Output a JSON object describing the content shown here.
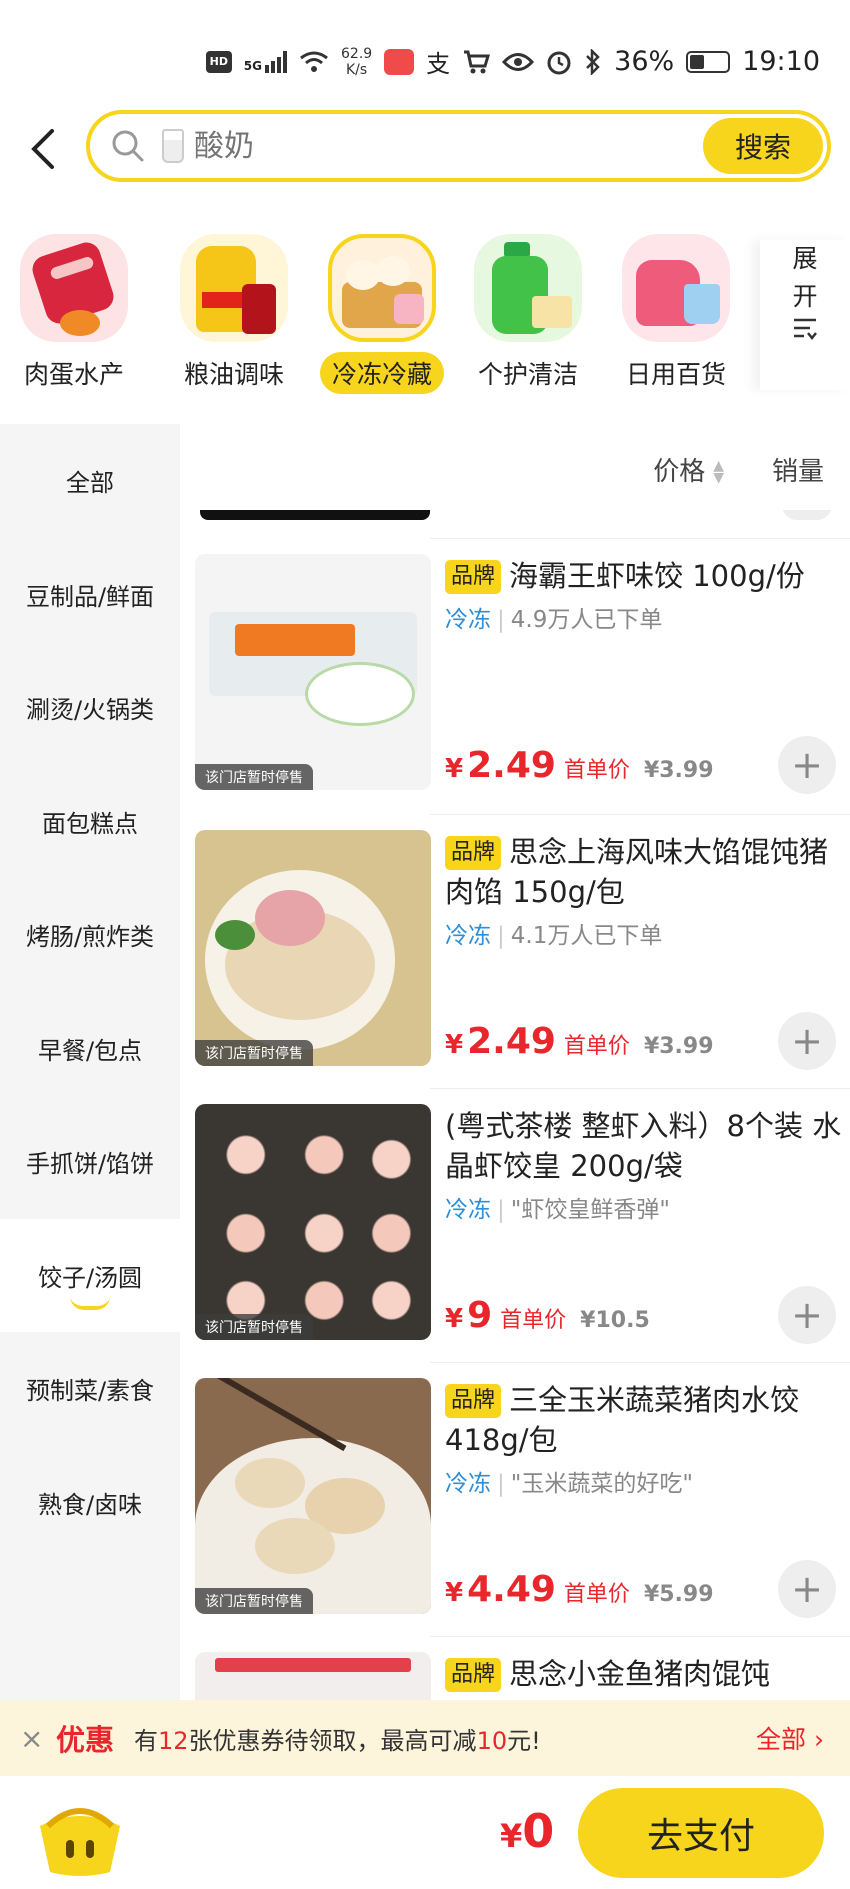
{
  "status_bar": {
    "hd": "HD",
    "net_type": "5G",
    "speed_value": "62.9",
    "speed_unit": "K/s",
    "battery": "36%",
    "time": "19:10"
  },
  "search": {
    "placeholder": "酸奶",
    "button": "搜索"
  },
  "categories": [
    {
      "label": "肉蛋水产",
      "active": false
    },
    {
      "label": "粮油调味",
      "active": false
    },
    {
      "label": "冷冻冷藏",
      "active": true
    },
    {
      "label": "个护清洁",
      "active": false
    },
    {
      "label": "日用百货",
      "active": false
    }
  ],
  "expand": {
    "line1": "展",
    "line2": "开"
  },
  "sidebar": {
    "items": [
      {
        "label": "全部"
      },
      {
        "label": "豆制品/鲜面"
      },
      {
        "label": "涮烫/火锅类"
      },
      {
        "label": "面包糕点"
      },
      {
        "label": "烤肠/煎炸类"
      },
      {
        "label": "早餐/包点"
      },
      {
        "label": "手抓饼/馅饼"
      },
      {
        "label": "饺子/汤圆"
      },
      {
        "label": "预制菜/素食"
      },
      {
        "label": "熟食/卤味"
      }
    ]
  },
  "sort": {
    "price": "价格",
    "sales": "销量"
  },
  "products": [
    {
      "brand": "品牌",
      "title": "海霸王虾味饺 100g/份",
      "frozen": "冷冻",
      "tag": "4.9万人已下单",
      "yen": "¥",
      "price": "2.49",
      "first": "首单价",
      "orig": "¥3.99",
      "paused": "该门店暂时停售"
    },
    {
      "brand": "品牌",
      "title": "思念上海风味大馅馄饨猪肉馅 150g/包",
      "frozen": "冷冻",
      "tag": "4.1万人已下单",
      "yen": "¥",
      "price": "2.49",
      "first": "首单价",
      "orig": "¥3.99",
      "paused": "该门店暂时停售"
    },
    {
      "brand": "",
      "title": "(粤式茶楼 整虾入料）8个装 水晶虾饺皇 200g/袋",
      "frozen": "冷冻",
      "tag": "\"虾饺皇鲜香弹\"",
      "yen": "¥",
      "price": "9",
      "first": "首单价",
      "orig": "¥10.5",
      "paused": "该门店暂时停售"
    },
    {
      "brand": "品牌",
      "title": "三全玉米蔬菜猪肉水饺 418g/包",
      "frozen": "冷冻",
      "tag": "\"玉米蔬菜的好吃\"",
      "yen": "¥",
      "price": "4.49",
      "first": "首单价",
      "orig": "¥5.99",
      "paused": "该门店暂时停售"
    },
    {
      "brand": "品牌",
      "title": "思念小金鱼猪肉馄饨",
      "frozen": "",
      "tag": "",
      "yen": "",
      "price": "",
      "first": "",
      "orig": "",
      "paused": ""
    }
  ],
  "coupon": {
    "close": "×",
    "title": "优惠",
    "text_a": "有",
    "count": "12",
    "text_b": "张优惠券待领取，最高可减",
    "amount": "10",
    "text_c": "元!",
    "all": "全部 ›"
  },
  "cart": {
    "yen": "¥",
    "total": "0",
    "pay": "去支付"
  },
  "colors": {
    "accent": "#f7d51d",
    "price": "#e8262b",
    "frozen": "#2d8ed9"
  }
}
